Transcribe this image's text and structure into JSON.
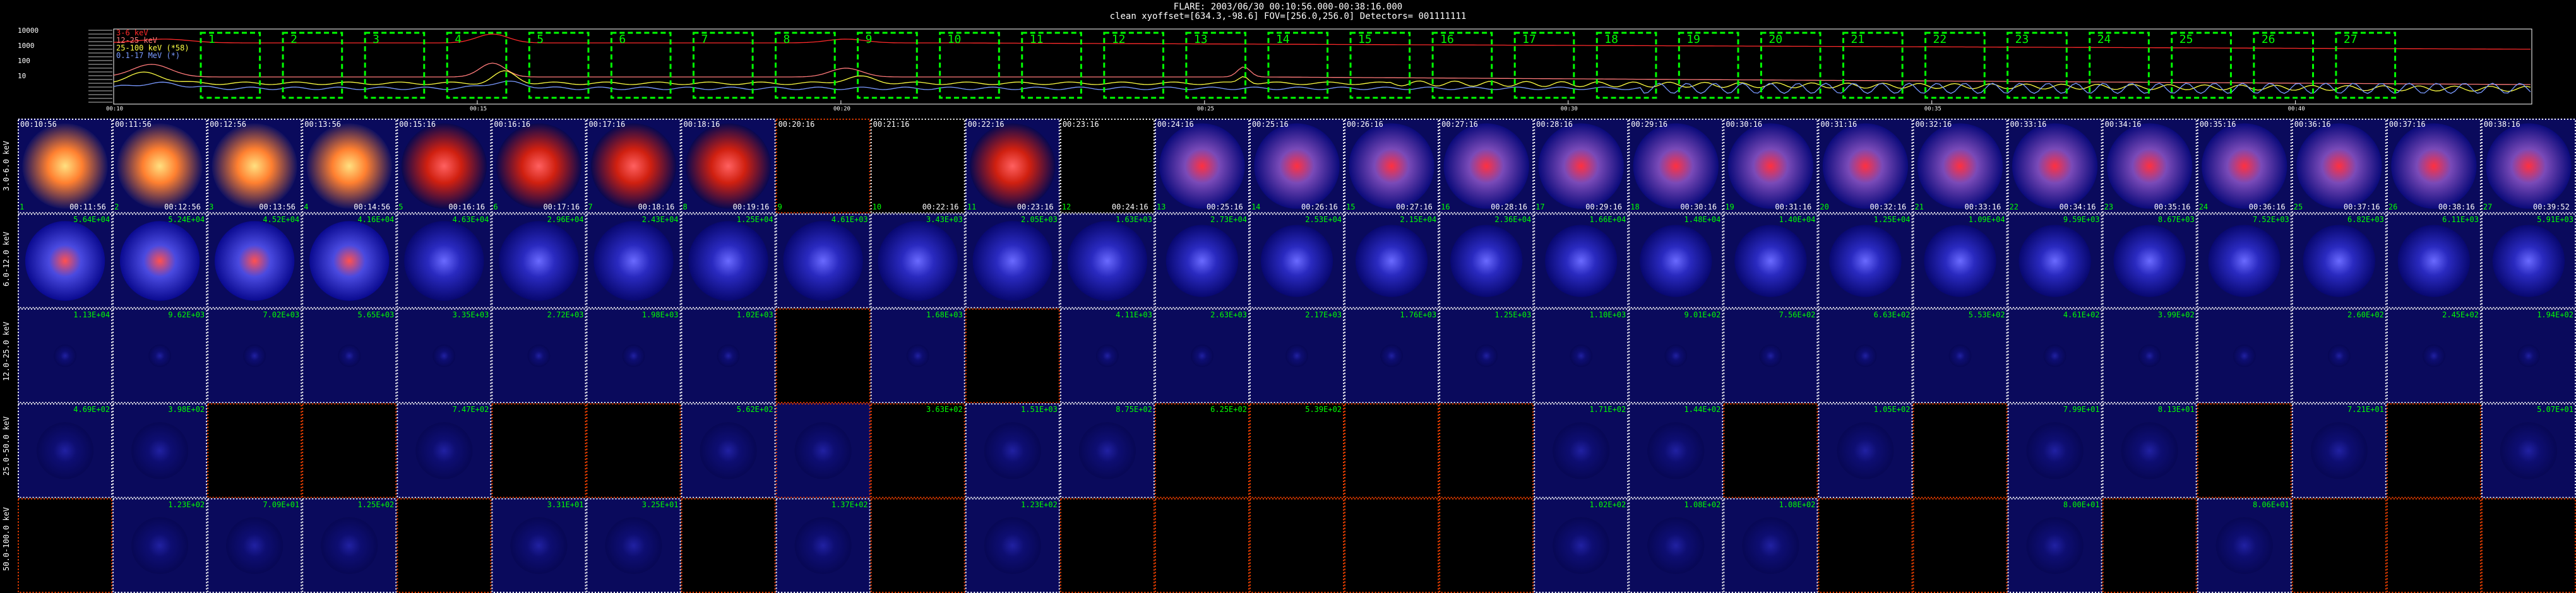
{
  "header": {
    "line1": "FLARE: 2003/06/30 00:10:56.000-00:38:16.000",
    "line2": "clean    xyoffset=[634.3,-98.6]    FOV=[256.0,256.0]    Detectors= 001111111"
  },
  "lightcurve": {
    "legend": [
      {
        "label": "3-6 keV",
        "color": "#ff2a2a"
      },
      {
        "label": "12-25 keV",
        "color": "#ff7a7a"
      },
      {
        "label": "25-100 keV (*58)",
        "color": "#ffff44"
      },
      {
        "label": "0.1-17 MeV (*)",
        "color": "#7a9aff"
      }
    ],
    "y_ticks": [
      "10000",
      "1000",
      "100",
      "10"
    ],
    "x_ticks": [
      "00:10",
      "00:15",
      "00:20",
      "00:25",
      "00:30",
      "00:35",
      "00:40"
    ],
    "intervals": [
      "1",
      "2",
      "3",
      "4",
      "5",
      "6",
      "7",
      "8",
      "9",
      "10",
      "11",
      "12",
      "13",
      "14",
      "15",
      "16",
      "17",
      "18",
      "19",
      "20",
      "21",
      "22",
      "23",
      "24",
      "25",
      "26",
      "27"
    ]
  },
  "energy_bands": [
    "3.0-6.0 keV",
    "6.0-12.0 keV",
    "12.0-25.0 keV",
    "25.0-50.0 keV",
    "50.0-100.0 keV"
  ],
  "columns": [
    {
      "start": "00:10:56",
      "end": "00:11:56"
    },
    {
      "start": "00:11:56",
      "end": "00:12:56"
    },
    {
      "start": "00:12:56",
      "end": "00:13:56"
    },
    {
      "start": "00:13:56",
      "end": "00:14:56"
    },
    {
      "start": "00:15:16",
      "end": "00:16:16"
    },
    {
      "start": "00:16:16",
      "end": "00:17:16"
    },
    {
      "start": "00:17:16",
      "end": "00:18:16"
    },
    {
      "start": "00:18:16",
      "end": "00:19:16"
    },
    {
      "start": "00:20:16",
      "end": "00:21:16"
    },
    {
      "start": "00:21:16",
      "end": "00:22:16"
    },
    {
      "start": "00:22:16",
      "end": "00:23:16"
    },
    {
      "start": "00:23:16",
      "end": "00:24:16"
    },
    {
      "start": "00:24:16",
      "end": "00:25:16"
    },
    {
      "start": "00:25:16",
      "end": "00:26:16"
    },
    {
      "start": "00:26:16",
      "end": "00:27:16"
    },
    {
      "start": "00:27:16",
      "end": "00:28:16"
    },
    {
      "start": "00:28:16",
      "end": "00:29:16"
    },
    {
      "start": "00:29:16",
      "end": "00:30:16"
    },
    {
      "start": "00:30:16",
      "end": "00:31:16"
    },
    {
      "start": "00:31:16",
      "end": "00:32:16"
    },
    {
      "start": "00:32:16",
      "end": "00:33:16"
    },
    {
      "start": "00:33:16",
      "end": "00:34:16"
    },
    {
      "start": "00:34:16",
      "end": "00:35:16"
    },
    {
      "start": "00:35:16",
      "end": "00:36:16"
    },
    {
      "start": "00:36:16",
      "end": "00:37:16"
    },
    {
      "start": "00:37:16",
      "end": "00:38:16"
    },
    {
      "start": "00:38:16",
      "end": "00:39:52"
    }
  ],
  "flux_rows": [
    [
      "",
      "",
      "",
      "",
      "",
      "",
      "",
      "",
      "",
      "",
      "",
      "",
      "",
      "",
      "",
      "",
      "",
      "",
      "",
      "",
      "",
      "",
      "",
      "",
      "",
      "",
      ""
    ],
    [
      "5.64E+04",
      "5.24E+04",
      "4.52E+04",
      "4.16E+04",
      "4.63E+04",
      "2.96E+04",
      "2.43E+04",
      "1.25E+04",
      "4.61E+03",
      "3.43E+03",
      "2.05E+03",
      "1.63E+03",
      "2.73E+04",
      "2.53E+04",
      "2.15E+04",
      "2.36E+04",
      "1.66E+04",
      "1.48E+04",
      "1.40E+04",
      "1.25E+04",
      "1.09E+04",
      "9.59E+03",
      "8.67E+03",
      "7.52E+03",
      "6.82E+03",
      "6.11E+03",
      "5.91E+03"
    ],
    [
      "1.13E+04",
      "9.62E+03",
      "7.02E+03",
      "5.65E+03",
      "3.35E+03",
      "2.72E+03",
      "1.98E+03",
      "1.02E+03",
      "",
      "1.68E+03",
      "",
      "4.11E+03",
      "2.63E+03",
      "2.17E+03",
      "1.76E+03",
      "1.25E+03",
      "1.10E+03",
      "9.01E+02",
      "7.56E+02",
      "6.63E+02",
      "5.53E+02",
      "4.61E+02",
      "3.99E+02",
      "",
      "2.60E+02",
      "2.45E+02",
      "1.94E+02"
    ],
    [
      "4.69E+02",
      "3.98E+02",
      "",
      "",
      "7.47E+02",
      "",
      "",
      "5.62E+02",
      "",
      "3.63E+02",
      "1.51E+03",
      "8.75E+02",
      "6.25E+02",
      "5.39E+02",
      "",
      "",
      "1.71E+02",
      "1.44E+02",
      "",
      "1.05E+02",
      "",
      "7.99E+01",
      "8.13E+01",
      "",
      "7.21E+01",
      "",
      "5.07E+01"
    ],
    [
      "",
      "1.23E+02",
      "7.09E+01",
      "1.25E+02",
      "",
      "3.31E+01",
      "3.25E+01",
      "",
      "1.37E+02",
      "",
      "1.23E+02",
      "",
      "",
      "",
      "",
      "",
      "1.02E+02",
      "1.08E+02",
      "1.08E+02",
      "",
      "",
      "8.00E+01",
      "",
      "8.06E+01",
      "",
      "",
      ""
    ]
  ],
  "colors": {
    "green": "#00ff00",
    "red": "#ff2222",
    "grid_white": "#ffffff",
    "grid_red": "#ff4400"
  }
}
